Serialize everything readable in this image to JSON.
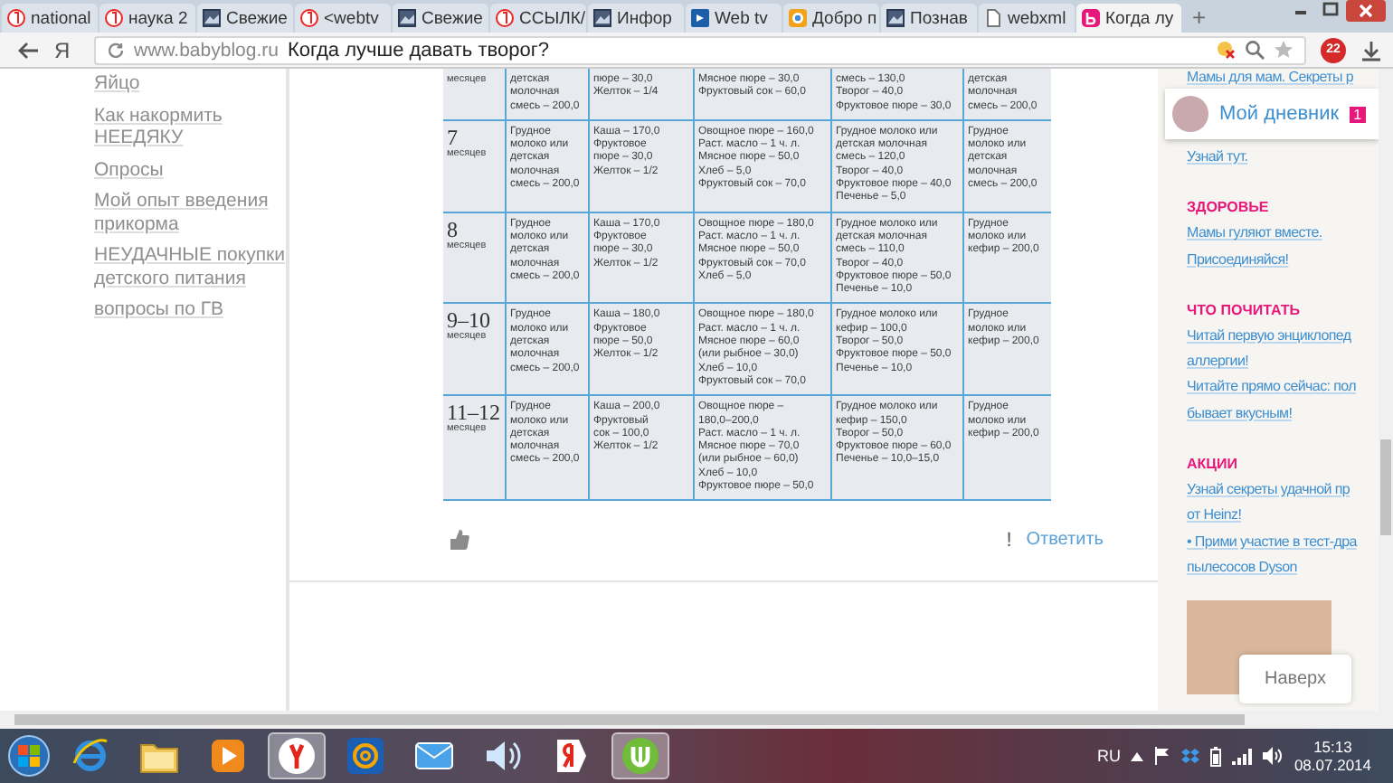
{
  "browser": {
    "tabs": [
      {
        "title": "national",
        "kind": "ya",
        "selected": false
      },
      {
        "title": "наука 2",
        "kind": "ya",
        "selected": false
      },
      {
        "title": "Свежие",
        "kind": "photo",
        "selected": false
      },
      {
        "title": "<webtv",
        "kind": "ya",
        "selected": false
      },
      {
        "title": "Свежие",
        "kind": "photo",
        "selected": false
      },
      {
        "title": "ССЫЛК/",
        "kind": "ya",
        "selected": false
      },
      {
        "title": "Инфор",
        "kind": "photo",
        "selected": false
      },
      {
        "title": "Web tv",
        "kind": "web",
        "selected": false
      },
      {
        "title": "Добро п",
        "kind": "orange",
        "selected": false
      },
      {
        "title": "Познав",
        "kind": "photo",
        "selected": false
      },
      {
        "title": "webxml",
        "kind": "page",
        "selected": false
      },
      {
        "title": "Когда лу",
        "kind": "bb",
        "selected": true
      }
    ],
    "new_tab": "+",
    "logo": "Я",
    "url_host": "www.babyblog.ru",
    "page_title": "Когда лучше давать творог?",
    "badge": "22"
  },
  "sidebar": {
    "links": [
      "Яйцо",
      "Как накормить НЕЕДЯКУ",
      "Опросы",
      "Мой опыт введения прикорма",
      "НЕУДАЧНЫЕ покупки детского питания",
      "вопросы по ГВ"
    ]
  },
  "post": {
    "table": {
      "rows": [
        {
          "month": "",
          "unit": "месяцев",
          "cells": [
            "детская\nмолочная\nсмесь – 200,0",
            "пюре – 30,0\nЖелток – 1/4",
            "Мясное пюре – 30,0\nФруктовый сок – 60,0",
            "смесь – 130,0\nТворог – 40,0\nФруктовое пюре – 30,0",
            "детская\nмолочная\nсмесь – 200,0"
          ]
        },
        {
          "month": "7",
          "unit": "месяцев",
          "cells": [
            "Грудное\nмолоко или\nдетская\nмолочная\nсмесь – 200,0",
            "Каша – 170,0\nФруктовое\nпюре – 30,0\nЖелток – 1/2",
            "Овощное пюре – 160,0\nРаст. масло – 1 ч. л.\nМясное пюре – 50,0\nХлеб – 5,0\nФруктовый сок – 70,0",
            "Грудное молоко или\nдетская молочная\nсмесь – 120,0\nТворог – 40,0\nФруктовое пюре – 40,0\nПеченье – 5,0",
            "Грудное\nмолоко или\nдетская\nмолочная\nсмесь – 200,0"
          ]
        },
        {
          "month": "8",
          "unit": "месяцев",
          "cells": [
            "Грудное\nмолоко или\nдетская\nмолочная\nсмесь – 200,0",
            "Каша – 170,0\nФруктовое\nпюре – 30,0\nЖелток – 1/2",
            "Овощное пюре – 180,0\nРаст. масло – 1 ч. л.\nМясное пюре – 50,0\nФруктовый сок – 70,0\nХлеб – 5,0",
            "Грудное молоко или\nдетская молочная\nсмесь – 110,0\nТворог – 40,0\nФруктовое пюре – 50,0\nПеченье – 10,0",
            "Грудное\nмолоко или\nкефир – 200,0"
          ]
        },
        {
          "month": "9–10",
          "unit": "месяцев",
          "cells": [
            "Грудное\nмолоко или\nдетская\nмолочная\nсмесь – 200,0",
            "Каша – 180,0\nФруктовое\nпюре – 50,0\nЖелток – 1/2",
            "Овощное пюре – 180,0\nРаст. масло – 1 ч. л.\nМясное пюре – 60,0\n(или рыбное – 30,0)\nХлеб – 10,0\nФруктовый сок – 70,0",
            "Грудное молоко или\nкефир – 100,0\nТворог – 50,0\nФруктовое пюре – 50,0\nПеченье – 10,0",
            "Грудное\nмолоко или\nкефир – 200,0"
          ]
        },
        {
          "month": "11–12",
          "unit": "месяцев",
          "cells": [
            "Грудное\nмолоко или\nдетская\nмолочная\nсмесь – 200,0",
            "Каша – 200,0\nФруктовый\nсок – 100,0\nЖелток – 1/2",
            "Овощное пюре –\n180,0–200,0\nРаст. масло – 1 ч. л.\nМясное пюре – 70,0\n(или рыбное – 60,0)\nХлеб – 10,0\nФруктовое пюре – 50,0",
            "Грудное молоко или\nкефир – 150,0\nТворог – 50,0\nФруктовое пюре – 60,0\nПеченье – 10,0–15,0",
            "Грудное\nмолоко или\nкефир – 200,0"
          ]
        }
      ]
    },
    "actions": {
      "flag": "!",
      "reply": "Ответить"
    }
  },
  "right": {
    "intro": [
      "Мамы для мам. Секреты р",
      "Узнай тут."
    ],
    "sections": [
      {
        "heading": "ЗДОРОВЬЕ",
        "links": [
          [
            "Мамы гуляют вместе.",
            "Присоединяйся!"
          ]
        ]
      },
      {
        "heading": "ЧТО ПОЧИТАТЬ",
        "links": [
          [
            "Читай первую энциклопед",
            "аллергии!"
          ],
          [
            "Читайте прямо сейчас: пол",
            "бывает вкусным!"
          ]
        ]
      },
      {
        "heading": "АКЦИИ",
        "links": [
          [
            "Узнай секреты удачной пр",
            "от Heinz!"
          ],
          [
            "• Прими участие в тест-дра",
            "пылесосов Dyson"
          ]
        ]
      }
    ]
  },
  "diary": {
    "label": "Мой дневник",
    "count": "1"
  },
  "to_top": "Наверх",
  "taskbar": {
    "apps": [
      {
        "kind": "ie",
        "selected": false
      },
      {
        "kind": "folder",
        "selected": false
      },
      {
        "kind": "media",
        "selected": false
      },
      {
        "kind": "ybrowser",
        "selected": true
      },
      {
        "kind": "agent",
        "selected": false
      },
      {
        "kind": "mail",
        "selected": false
      },
      {
        "kind": "speaker",
        "selected": false
      },
      {
        "kind": "yandex",
        "selected": false
      },
      {
        "kind": "torrent",
        "selected": true
      }
    ],
    "lang": "RU",
    "time": "15:13",
    "date": "08.07.2014"
  }
}
